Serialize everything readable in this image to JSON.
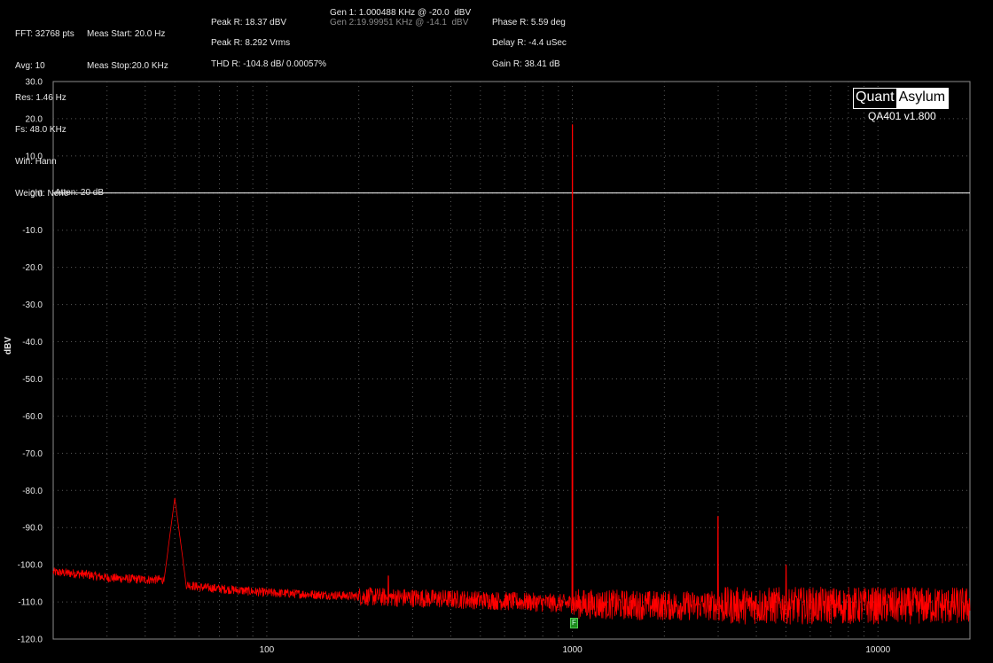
{
  "header": {
    "col1": [
      "FFT: 32768 pts",
      "Avg: 10",
      "Res: 1.46 Hz",
      "Fs: 48.0 KHz",
      "Win: Hann",
      "Weight: None"
    ],
    "col2": [
      "Meas Start: 20.0 Hz",
      "Meas Stop:20.0 KHz"
    ],
    "peak_dbv": "Peak R: 18.37 dBV",
    "peak_vrms": "Peak R: 8.292 Vrms",
    "thd": "THD R: -104.8 dB/ 0.00057%",
    "gen1": "Gen 1: 1.000488 KHz @ -20.0  dBV",
    "gen2": "Gen 2:19.99951 KHz @ -14.1  dBV",
    "phase": "Phase R: 5.59 deg",
    "delay": "Delay R: -4.4 uSec",
    "gain": "Gain R: 38.41 dB"
  },
  "logo": {
    "left": "Quant",
    "right": "Asylum",
    "version": "QA401 v1.800"
  },
  "annotation": {
    "atten": "Atten: 20 dB",
    "marker": "F"
  },
  "colors": {
    "trace": "#ff0000",
    "grid": "#5a5a5a",
    "background": "#000000",
    "reference_line": "#ffffff",
    "marker": "#1f8a1f"
  },
  "chart_data": {
    "type": "line",
    "xscale": "log",
    "xlim": [
      20,
      20000
    ],
    "ylim": [
      -120,
      30
    ],
    "ylabel": "dBV",
    "xlabel": "",
    "x_ticks": [
      100,
      1000,
      10000
    ],
    "x_tick_labels": [
      "100",
      "1000",
      "10000"
    ],
    "y_ticks": [
      30,
      20,
      10,
      0,
      -10,
      -20,
      -30,
      -40,
      -50,
      -60,
      -70,
      -80,
      -90,
      -100,
      -110,
      -120
    ],
    "y_tick_labels": [
      "30.0",
      "20.0",
      "10.0",
      "0.0",
      "-10.0",
      "-20.0",
      "-30.0",
      "-40.0",
      "-50.0",
      "-60.0",
      "-70.0",
      "-80.0",
      "-90.0",
      "-100.0",
      "-110.0",
      "-120.0"
    ],
    "grid": true,
    "reference_line_y": 0,
    "series": [
      {
        "color": "#ff0000",
        "noise_floor": [
          [
            20,
            -102
          ],
          [
            25,
            -102.5
          ],
          [
            30,
            -103.5
          ],
          [
            40,
            -104
          ],
          [
            45,
            -104
          ],
          [
            60,
            -106
          ],
          [
            100,
            -107.5
          ],
          [
            200,
            -108.5
          ],
          [
            500,
            -109.5
          ],
          [
            1000,
            -110.5
          ],
          [
            2000,
            -111
          ],
          [
            5000,
            -111
          ],
          [
            10000,
            -111
          ],
          [
            20000,
            -111
          ]
        ],
        "peaks": [
          {
            "x": 50,
            "y": -82
          },
          {
            "x": 250,
            "y": -103
          },
          {
            "x": 1000,
            "y": 18.4
          },
          {
            "x": 3000,
            "y": -87
          },
          {
            "x": 5000,
            "y": -100
          }
        ]
      }
    ]
  }
}
